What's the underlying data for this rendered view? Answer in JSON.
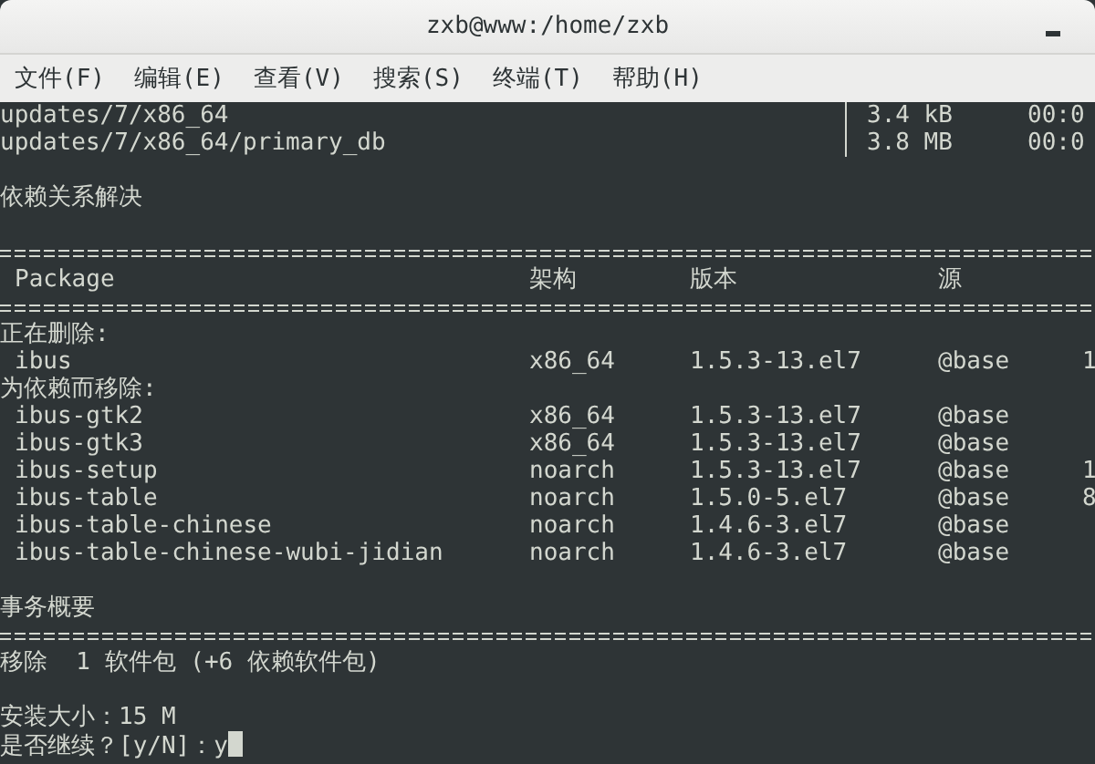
{
  "window": {
    "title": "zxb@www:/home/zxb"
  },
  "menu": [
    "文件(F)",
    "编辑(E)",
    "查看(V)",
    "搜索(S)",
    "终端(T)",
    "帮助(H)"
  ],
  "terminal": {
    "downloads": [
      {
        "name": "updates/7/x86_64",
        "size": "3.4 kB",
        "time": "00:0"
      },
      {
        "name": "updates/7/x86_64/primary_db",
        "size": "3.8 MB",
        "time": "00:0"
      }
    ],
    "resolve_message": "依赖关系解决",
    "table": {
      "columns": [
        "Package",
        "架构",
        "版本",
        "源"
      ],
      "groups": [
        {
          "heading": "正在删除:",
          "rows": [
            {
              "package": "ibus",
              "arch": "x86_64",
              "version": "1.5.3-13.el7",
              "repo": "@base",
              "column_5": "1"
            }
          ]
        },
        {
          "heading": "为依赖而移除:",
          "rows": [
            {
              "package": "ibus-gtk2",
              "arch": "x86_64",
              "version": "1.5.3-13.el7",
              "repo": "@base",
              "column_5": ""
            },
            {
              "package": "ibus-gtk3",
              "arch": "x86_64",
              "version": "1.5.3-13.el7",
              "repo": "@base",
              "column_5": ""
            },
            {
              "package": "ibus-setup",
              "arch": "noarch",
              "version": "1.5.3-13.el7",
              "repo": "@base",
              "column_5": "1"
            },
            {
              "package": "ibus-table",
              "arch": "noarch",
              "version": "1.5.0-5.el7",
              "repo": "@base",
              "column_5": "8"
            },
            {
              "package": "ibus-table-chinese",
              "arch": "noarch",
              "version": "1.4.6-3.el7",
              "repo": "@base",
              "column_5": ""
            },
            {
              "package": "ibus-table-chinese-wubi-jidian",
              "arch": "noarch",
              "version": "1.4.6-3.el7",
              "repo": "@base",
              "column_5": ""
            }
          ]
        }
      ]
    },
    "summary_heading": "事务概要",
    "summary": "移除  1 软件包 (+6 依赖软件包)",
    "install_size": "安装大小：15 M",
    "prompt": "是否继续？[y/N]：",
    "input": "y"
  }
}
